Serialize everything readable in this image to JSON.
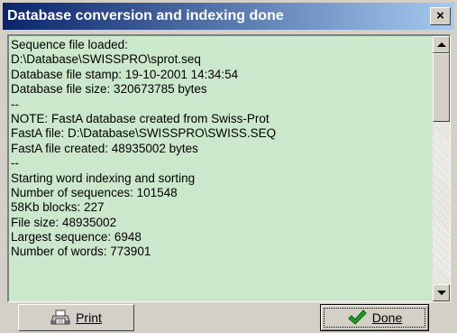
{
  "window": {
    "title": "Database conversion and indexing done",
    "close_glyph": "×"
  },
  "log": {
    "lines": [
      "Sequence file loaded:",
      "D:\\Database\\SWISSPRO\\sprot.seq",
      "Database file stamp: 19-10-2001 14:34:54",
      "Database file size: 320673785 bytes",
      "--",
      "NOTE: FastA database created from Swiss-Prot",
      "FastA file: D:\\Database\\SWISSPRO\\SWISS.SEQ",
      "FastA file created: 48935002 bytes",
      "--",
      "Starting word indexing and sorting",
      "Number of sequences: 101548",
      "58Kb blocks: 227",
      "File size: 48935002",
      "Largest sequence: 6948",
      "Number of words: 773901"
    ],
    "background_color": "#cce8cc"
  },
  "buttons": {
    "print_label": "Print",
    "print_icon": "printer-icon",
    "done_label": "Done",
    "done_icon": "checkmark-icon"
  },
  "colors": {
    "title_gradient_start": "#0a246a",
    "title_gradient_end": "#a6caf0",
    "face": "#d4d0c8",
    "check_green": "#1fa01f"
  }
}
